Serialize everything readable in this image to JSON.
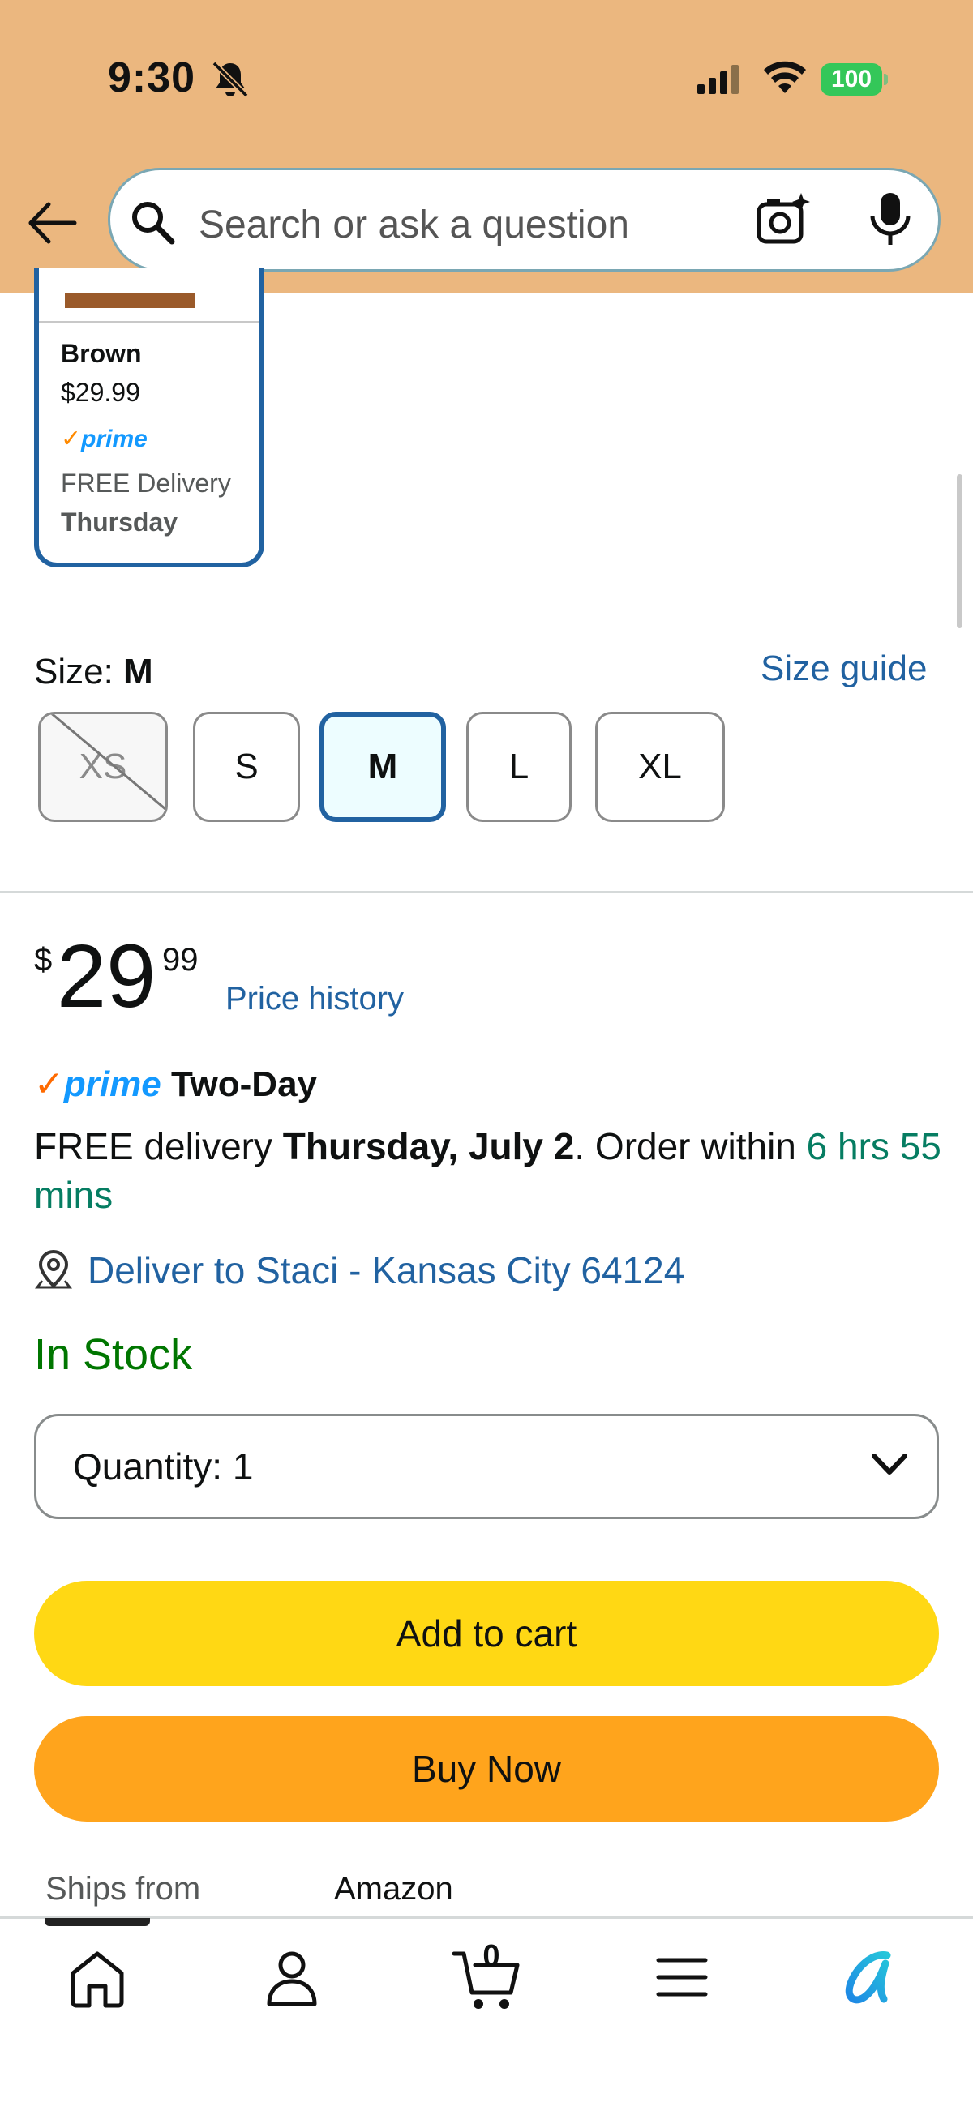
{
  "status_bar": {
    "time": "9:30",
    "battery": "100"
  },
  "search": {
    "placeholder": "Search or ask a question"
  },
  "color_option": {
    "name": "Brown",
    "price": "$29.99",
    "prime": "prime",
    "delivery": "FREE Delivery",
    "day": "Thursday"
  },
  "size": {
    "label": "Size: ",
    "selected": "M",
    "guide": "Size guide",
    "options": [
      "XS",
      "S",
      "M",
      "L",
      "XL"
    ]
  },
  "price": {
    "symbol": "$",
    "whole": "29",
    "fraction": "99",
    "history": "Price history"
  },
  "delivery": {
    "prime": "prime",
    "prime_tier": "Two-Day",
    "free_text": "FREE delivery ",
    "date": "Thursday, July 2",
    "order_within": ". Order within ",
    "countdown": "6 hrs 55 mins",
    "deliver_to": "Deliver to Staci - Kansas City 64124"
  },
  "stock": {
    "status": "In Stock"
  },
  "quantity": {
    "label": "Quantity:  1"
  },
  "buttons": {
    "add_to_cart": "Add to cart",
    "buy_now": "Buy Now"
  },
  "ships_from": {
    "label": "Ships from",
    "value": "Amazon"
  },
  "bottom_nav": {
    "cart_count": "0",
    "items": [
      "home-icon",
      "account-icon",
      "cart-icon",
      "menu-icon",
      "rufus-icon"
    ]
  },
  "colors": {
    "header_bg": "#ebb77f",
    "link": "#2162a1",
    "in_stock": "#007600",
    "add_to_cart": "#ffd814",
    "buy_now": "#ffa41c",
    "prime_blue": "#1399ff"
  }
}
